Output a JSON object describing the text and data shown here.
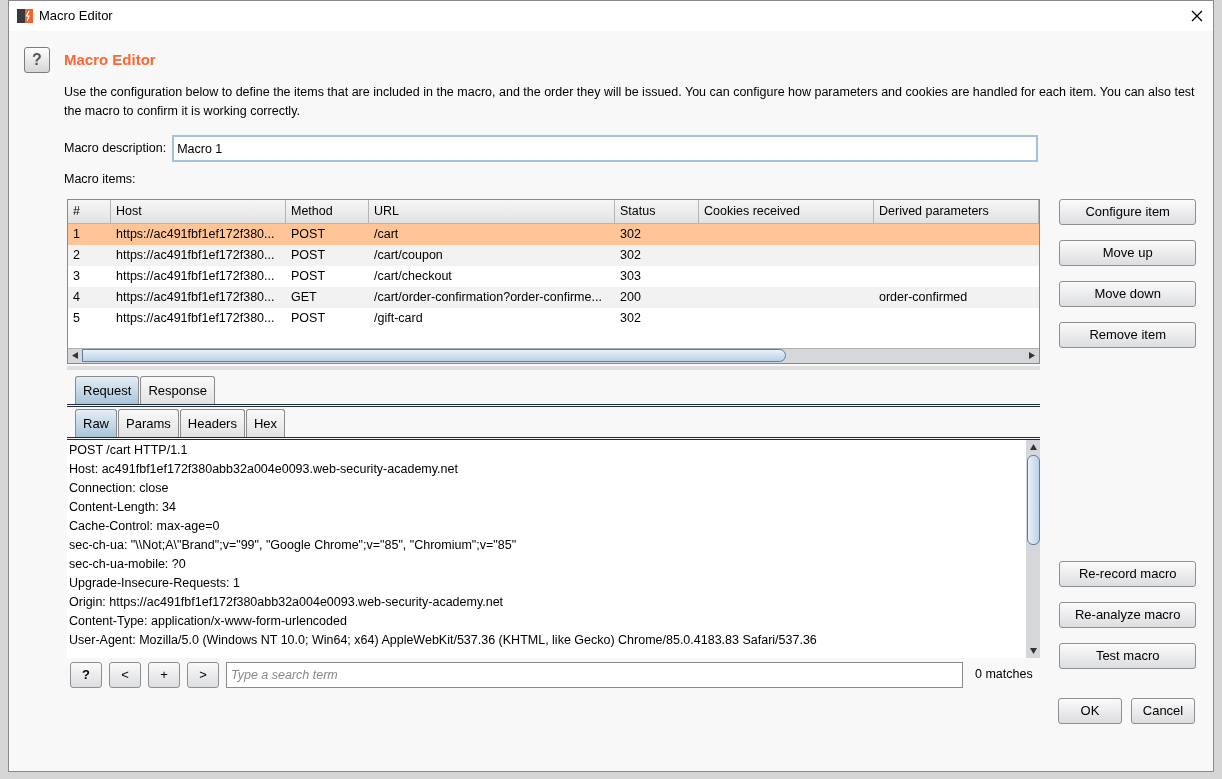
{
  "window": {
    "title": "Macro Editor"
  },
  "help_button": "?",
  "heading": "Macro Editor",
  "description": "Use the configuration below to define the items that are included in the macro, and the order they will be issued. You can configure how parameters and cookies are handled for each item. You can also test the macro to confirm it is working correctly.",
  "macro_description": {
    "label": "Macro description:",
    "value": "Macro 1"
  },
  "items_label": "Macro items:",
  "table": {
    "columns": [
      "#",
      "Host",
      "Method",
      "URL",
      "Status",
      "Cookies received",
      "Derived parameters"
    ],
    "rows": [
      {
        "cells": [
          "1",
          "https://ac491fbf1ef172f380...",
          "POST",
          "/cart",
          "302",
          "",
          ""
        ],
        "selected": true
      },
      {
        "cells": [
          "2",
          "https://ac491fbf1ef172f380...",
          "POST",
          "/cart/coupon",
          "302",
          "",
          ""
        ],
        "selected": false
      },
      {
        "cells": [
          "3",
          "https://ac491fbf1ef172f380...",
          "POST",
          "/cart/checkout",
          "303",
          "",
          ""
        ],
        "selected": false
      },
      {
        "cells": [
          "4",
          "https://ac491fbf1ef172f380...",
          "GET",
          "/cart/order-confirmation?order-confirme...",
          "200",
          "",
          "order-confirmed"
        ],
        "selected": false
      },
      {
        "cells": [
          "5",
          "https://ac491fbf1ef172f380...",
          "POST",
          "/gift-card",
          "302",
          "",
          ""
        ],
        "selected": false
      }
    ]
  },
  "item_buttons": [
    "Configure item",
    "Move up",
    "Move down",
    "Remove item"
  ],
  "message_tabs": [
    {
      "label": "Request",
      "selected": true
    },
    {
      "label": "Response",
      "selected": false
    }
  ],
  "view_tabs": [
    {
      "label": "Raw",
      "selected": true
    },
    {
      "label": "Params",
      "selected": false
    },
    {
      "label": "Headers",
      "selected": false
    },
    {
      "label": "Hex",
      "selected": false
    }
  ],
  "request_lines": [
    "POST /cart HTTP/1.1",
    "Host: ac491fbf1ef172f380abb32a004e0093.web-security-academy.net",
    "Connection: close",
    "Content-Length: 34",
    "Cache-Control: max-age=0",
    "sec-ch-ua: \"\\\\Not;A\\\"Brand\";v=\"99\", \"Google Chrome\";v=\"85\", \"Chromium\";v=\"85\"",
    "sec-ch-ua-mobile: ?0",
    "Upgrade-Insecure-Requests: 1",
    "Origin: https://ac491fbf1ef172f380abb32a004e0093.web-security-academy.net",
    "Content-Type: application/x-www-form-urlencoded",
    "User-Agent: Mozilla/5.0 (Windows NT 10.0; Win64; x64) AppleWebKit/537.36 (KHTML, like Gecko) Chrome/85.0.4183.83 Safari/537.36"
  ],
  "search_bar": {
    "help": "?",
    "prev": "<",
    "add": "+",
    "next": ">",
    "placeholder": "Type a search term",
    "matches": "0 matches"
  },
  "macro_buttons": [
    "Re-record macro",
    "Re-analyze macro",
    "Test macro"
  ],
  "footer_buttons": [
    "OK",
    "Cancel"
  ]
}
